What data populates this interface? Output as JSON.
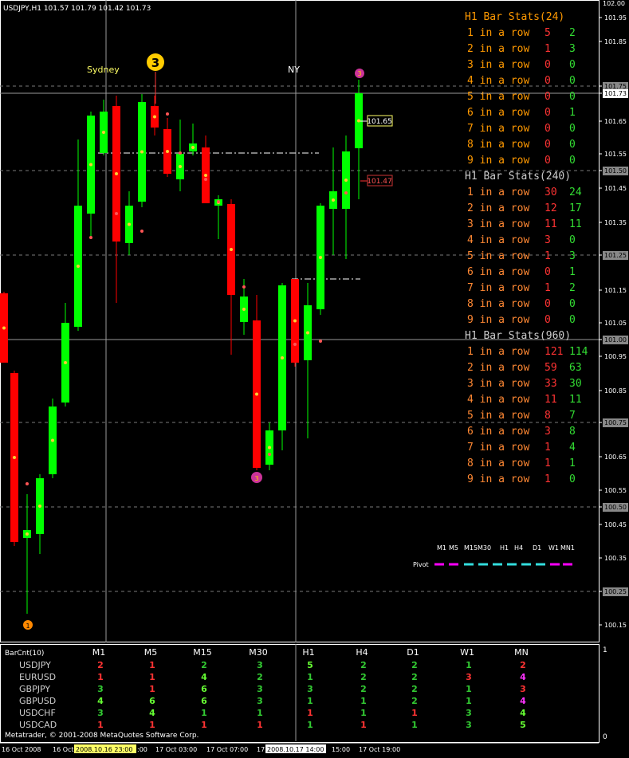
{
  "header": {
    "title": "USDJPY,H1  101.57 101.79 101.42 101.73"
  },
  "price_axis": {
    "labels": [
      "101.95",
      "101.85",
      "101.75",
      "101.73",
      "101.65",
      "101.55",
      "101.50",
      "101.45",
      "101.35",
      "101.25",
      "101.15",
      "101.05",
      "101.00",
      "100.95",
      "100.85",
      "100.75",
      "100.65",
      "100.55",
      "100.50",
      "100.45",
      "100.35",
      "100.25",
      "100.15"
    ],
    "top_label": "102.00"
  },
  "time_axis": {
    "labels": [
      "16 Oct 2008",
      "16 Oct 2008 ",
      "17 Oct 03:00",
      "17 Oct 07:00",
      "17 Oct 11:00",
      "17 Oct 15:00",
      "17 Oct 19:00"
    ],
    "highlight_left": "2008.10.16 23:00",
    "highlight_right": "2008.10.17 14:00"
  },
  "sessions": {
    "sydney": "Sydney",
    "ny": "NY"
  },
  "markers": {
    "big_count": "3",
    "top_right_count": "3",
    "bottom_count": "3",
    "start_count": "1"
  },
  "price_tags": {
    "upper": "101.65",
    "lower": "101.47"
  },
  "stats": [
    {
      "title": "H1 Bar Stats(24)",
      "rows": [
        {
          "label": "1 in a row",
          "red": "5",
          "green": "2"
        },
        {
          "label": "2 in a row",
          "red": "1",
          "green": "3"
        },
        {
          "label": "3 in a row",
          "red": "0",
          "green": "0"
        },
        {
          "label": "4 in a row",
          "red": "0",
          "green": "0"
        },
        {
          "label": "5 in a row",
          "red": "0",
          "green": "0"
        },
        {
          "label": "6 in a row",
          "red": "0",
          "green": "1"
        },
        {
          "label": "7 in a row",
          "red": "0",
          "green": "0"
        },
        {
          "label": "8 in a row",
          "red": "0",
          "green": "0"
        },
        {
          "label": "9 in a row",
          "red": "0",
          "green": "0"
        }
      ]
    },
    {
      "title": "H1 Bar Stats(240)",
      "rows": [
        {
          "label": "1 in a row",
          "red": "30",
          "green": "24"
        },
        {
          "label": "2 in a row",
          "red": "12",
          "green": "17"
        },
        {
          "label": "3 in a row",
          "red": "11",
          "green": "11"
        },
        {
          "label": "4 in a row",
          "red": "3",
          "green": "0"
        },
        {
          "label": "5 in a row",
          "red": "1",
          "green": "3"
        },
        {
          "label": "6 in a row",
          "red": "0",
          "green": "1"
        },
        {
          "label": "7 in a row",
          "red": "1",
          "green": "2"
        },
        {
          "label": "8 in a row",
          "red": "0",
          "green": "0"
        },
        {
          "label": "9 in a row",
          "red": "0",
          "green": "0"
        }
      ]
    },
    {
      "title": "H1 Bar Stats(960)",
      "rows": [
        {
          "label": "1 in a row",
          "red": "121",
          "green": "114"
        },
        {
          "label": "2 in a row",
          "red": "59",
          "green": "63"
        },
        {
          "label": "3 in a row",
          "red": "33",
          "green": "30"
        },
        {
          "label": "4 in a row",
          "red": "11",
          "green": "11"
        },
        {
          "label": "5 in a row",
          "red": "8",
          "green": "7"
        },
        {
          "label": "6 in a row",
          "red": "3",
          "green": "8"
        },
        {
          "label": "7 in a row",
          "red": "1",
          "green": "4"
        },
        {
          "label": "8 in a row",
          "red": "1",
          "green": "1"
        },
        {
          "label": "9 in a row",
          "red": "1",
          "green": "0"
        }
      ]
    }
  ],
  "pivot": {
    "timeframes": [
      "M1",
      "M5",
      "M15",
      "M30",
      "H1",
      "H4",
      "D1",
      "W1",
      "MN1"
    ],
    "label": "Pivot"
  },
  "subwindow": {
    "title": "BarCnt(10)",
    "axis_top": "1",
    "axis_bottom": "0",
    "columns": [
      "M1",
      "M5",
      "M15",
      "M30",
      "H1",
      "H4",
      "D1",
      "W1",
      "MN"
    ],
    "rows": [
      {
        "symbol": "USDJPY",
        "cells": [
          [
            "2",
            "red"
          ],
          [
            "1",
            "red"
          ],
          [
            "2",
            "green"
          ],
          [
            "3",
            "green"
          ],
          [
            "5",
            "lime"
          ],
          [
            "2",
            "green"
          ],
          [
            "2",
            "green"
          ],
          [
            "1",
            "green"
          ],
          [
            "2",
            "red"
          ]
        ]
      },
      {
        "symbol": "EURUSD",
        "cells": [
          [
            "1",
            "red"
          ],
          [
            "1",
            "red"
          ],
          [
            "4",
            "lime"
          ],
          [
            "2",
            "green"
          ],
          [
            "1",
            "green"
          ],
          [
            "2",
            "green"
          ],
          [
            "2",
            "green"
          ],
          [
            "3",
            "red"
          ],
          [
            "4",
            "magenta"
          ]
        ]
      },
      {
        "symbol": "GBPJPY",
        "cells": [
          [
            "3",
            "green"
          ],
          [
            "1",
            "red"
          ],
          [
            "6",
            "lime"
          ],
          [
            "3",
            "green"
          ],
          [
            "3",
            "green"
          ],
          [
            "2",
            "green"
          ],
          [
            "2",
            "green"
          ],
          [
            "1",
            "green"
          ],
          [
            "3",
            "red"
          ]
        ]
      },
      {
        "symbol": "GBPUSD",
        "cells": [
          [
            "4",
            "lime"
          ],
          [
            "6",
            "lime"
          ],
          [
            "6",
            "lime"
          ],
          [
            "3",
            "green"
          ],
          [
            "1",
            "green"
          ],
          [
            "1",
            "green"
          ],
          [
            "2",
            "green"
          ],
          [
            "1",
            "green"
          ],
          [
            "4",
            "magenta"
          ]
        ]
      },
      {
        "symbol": "USDCHF",
        "cells": [
          [
            "3",
            "green"
          ],
          [
            "4",
            "lime"
          ],
          [
            "1",
            "green"
          ],
          [
            "1",
            "green"
          ],
          [
            "1",
            "red"
          ],
          [
            "1",
            "green"
          ],
          [
            "1",
            "red"
          ],
          [
            "3",
            "green"
          ],
          [
            "4",
            "lime"
          ]
        ]
      },
      {
        "symbol": "USDCAD",
        "cells": [
          [
            "1",
            "red"
          ],
          [
            "1",
            "red"
          ],
          [
            "1",
            "red"
          ],
          [
            "1",
            "red"
          ],
          [
            "1",
            "green"
          ],
          [
            "1",
            "red"
          ],
          [
            "1",
            "green"
          ],
          [
            "3",
            "green"
          ],
          [
            "5",
            "lime"
          ]
        ]
      }
    ],
    "copyright": "Metatrader, © 2001-2008 MetaQuotes Software Corp."
  },
  "colors": {
    "bull": "#00ff00",
    "bear": "#ff0000",
    "grid": "#aaaaaa",
    "text": "#ffffff",
    "orange": "#ff9900",
    "magenta": "#ff00ff",
    "cyan": "#33dddd"
  }
}
